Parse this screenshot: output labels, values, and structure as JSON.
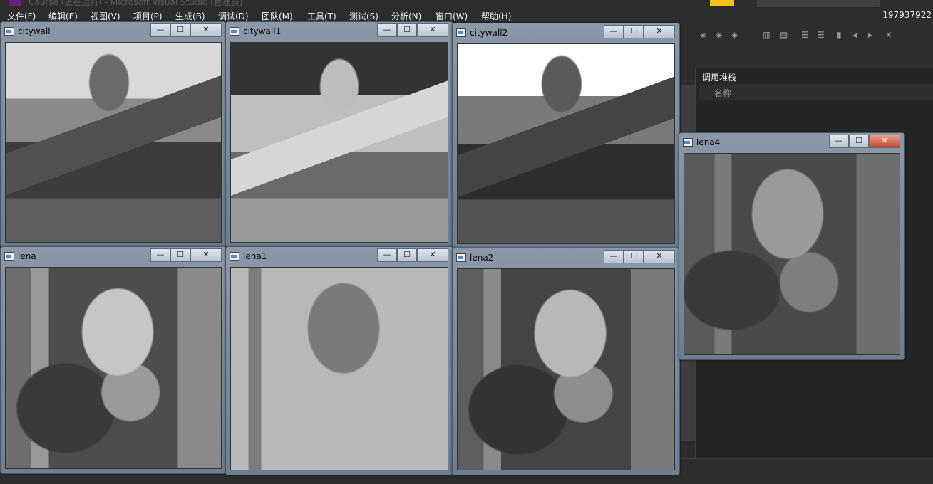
{
  "vs": {
    "title": "Course (正在运行) - Microsoft Visual Studio (管理员)",
    "user": "197937922",
    "menu": [
      "文件(F)",
      "编辑(E)",
      "视图(V)",
      "项目(P)",
      "生成(B)",
      "调试(D)",
      "团队(M)",
      "工具(T)",
      "测试(S)",
      "分析(N)",
      "窗口(W)",
      "帮助(H)"
    ],
    "pane": {
      "title": "调用堆栈",
      "column": "名称"
    },
    "colors": {
      "bg": "#2d2d30",
      "pane": "#252526",
      "text": "#f1f1f1"
    }
  },
  "windows": [
    {
      "title": "citywall",
      "image": "great-wall-grayscale"
    },
    {
      "title": "citywall1",
      "image": "great-wall-threshold"
    },
    {
      "title": "citywall2",
      "image": "great-wall-threshold-light"
    },
    {
      "title": "lena",
      "image": "lena-grayscale"
    },
    {
      "title": "lena1",
      "image": "lena-two-level"
    },
    {
      "title": "lena2",
      "image": "lena-grayscale-dark"
    },
    {
      "title": "lena4",
      "image": "lena-grayscale-low-contrast"
    }
  ],
  "window_buttons": {
    "minimize": "—",
    "maximize": "☐",
    "close": "✕"
  }
}
